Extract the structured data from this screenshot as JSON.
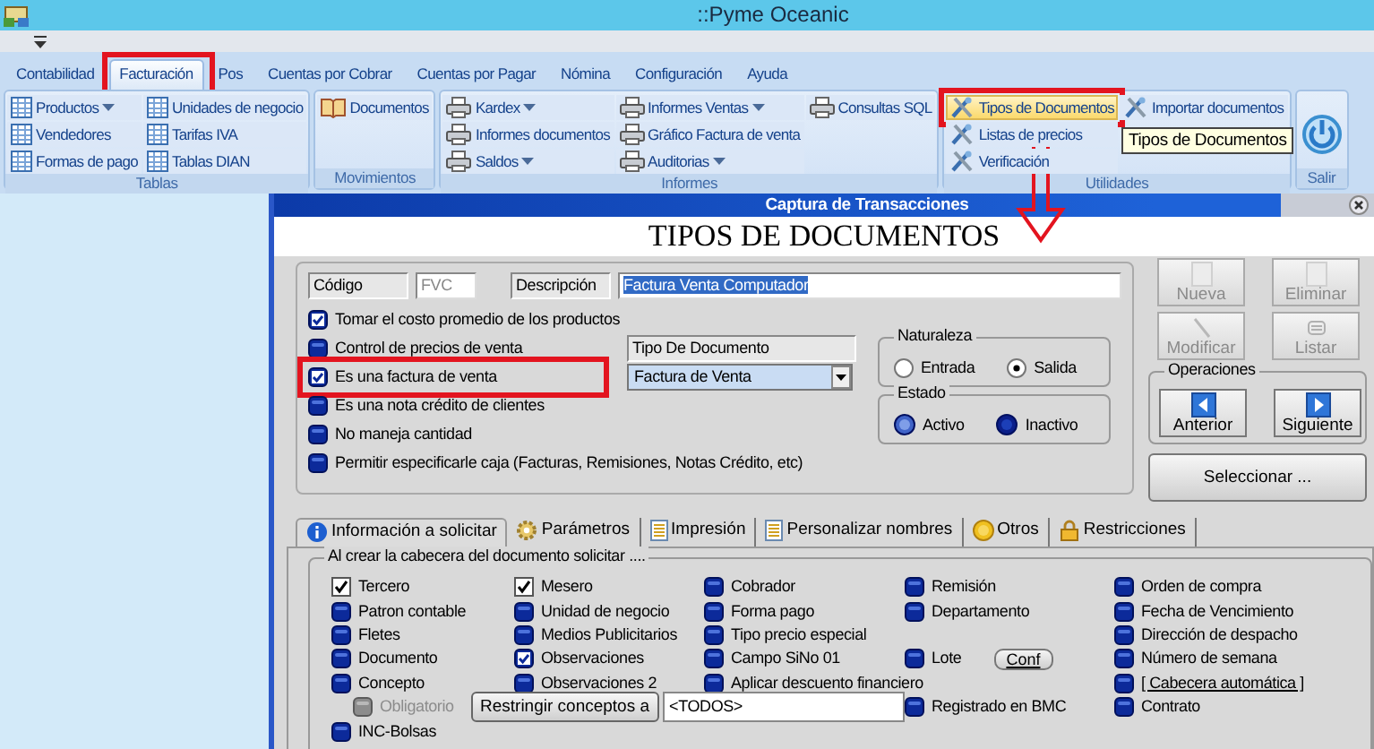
{
  "window": {
    "title": "::Pyme Oceanic"
  },
  "ribbon_tabs": [
    {
      "label": "Contabilidad",
      "selected": false,
      "highlighted": false
    },
    {
      "label": "Facturación",
      "selected": true,
      "highlighted": true
    },
    {
      "label": "Pos",
      "selected": false,
      "highlighted": false
    },
    {
      "label": "Cuentas por Cobrar",
      "selected": false,
      "highlighted": false
    },
    {
      "label": "Cuentas por Pagar",
      "selected": false,
      "highlighted": false
    },
    {
      "label": "Nómina",
      "selected": false,
      "highlighted": false
    },
    {
      "label": "Configuración",
      "selected": false,
      "highlighted": false
    },
    {
      "label": "Ayuda",
      "selected": false,
      "highlighted": false
    }
  ],
  "ribbon_groups": [
    {
      "title": "Tablas",
      "kind": "items",
      "columns": [
        [
          {
            "label": "Productos",
            "kind": "table",
            "dropdown": true,
            "hovered": false,
            "highlighted": false
          },
          {
            "label": "Vendedores",
            "kind": "table",
            "dropdown": false,
            "hovered": false,
            "highlighted": false
          },
          {
            "label": "Formas de pago",
            "kind": "table",
            "dropdown": false,
            "hovered": false,
            "highlighted": false
          }
        ],
        [
          {
            "label": "Unidades de negocio",
            "kind": "table",
            "dropdown": false,
            "hovered": false,
            "highlighted": false
          },
          {
            "label": "Tarifas IVA",
            "kind": "table",
            "dropdown": false,
            "hovered": false,
            "highlighted": false
          },
          {
            "label": "Tablas DIAN",
            "kind": "table",
            "dropdown": false,
            "hovered": false,
            "highlighted": false
          }
        ]
      ]
    },
    {
      "title": "Movimientos",
      "kind": "items",
      "columns": [
        [
          {
            "label": "Documentos",
            "kind": "book",
            "dropdown": false,
            "hovered": false,
            "highlighted": false
          }
        ]
      ]
    },
    {
      "title": "Informes",
      "kind": "items",
      "columns": [
        [
          {
            "label": "Kardex",
            "kind": "printer",
            "dropdown": true,
            "hovered": false,
            "highlighted": false
          },
          {
            "label": "Informes documentos",
            "kind": "printer",
            "dropdown": false,
            "hovered": false,
            "highlighted": false
          },
          {
            "label": "Saldos",
            "kind": "printer",
            "dropdown": true,
            "hovered": false,
            "highlighted": false
          }
        ],
        [
          {
            "label": "Informes Ventas",
            "kind": "printer",
            "dropdown": true,
            "hovered": false,
            "highlighted": false
          },
          {
            "label": "Gráfico Factura de venta",
            "kind": "printer",
            "dropdown": false,
            "hovered": false,
            "highlighted": false
          },
          {
            "label": "Auditorias",
            "kind": "printer",
            "dropdown": true,
            "hovered": false,
            "highlighted": false
          }
        ],
        [
          {
            "label": "Consultas SQL",
            "kind": "printer",
            "dropdown": false,
            "hovered": false,
            "highlighted": false
          }
        ]
      ]
    },
    {
      "title": "Utilidades",
      "kind": "items",
      "columns": [
        [
          {
            "label": "Tipos de Documentos",
            "kind": "tools",
            "dropdown": false,
            "hovered": true,
            "highlighted": true
          },
          {
            "label": "Listas de precios",
            "kind": "tools",
            "dropdown": false,
            "hovered": false,
            "highlighted": false
          },
          {
            "label": "Verificación",
            "kind": "tools",
            "dropdown": false,
            "hovered": false,
            "highlighted": false
          }
        ],
        [
          {
            "label": "Importar documentos",
            "kind": "tools",
            "dropdown": false,
            "hovered": false,
            "highlighted": false
          }
        ]
      ]
    },
    {
      "title": "Salir",
      "kind": "power"
    }
  ],
  "tooltip": {
    "text": "Tipos de Documentos"
  },
  "annotation_arrow": true,
  "dialog": {
    "title": "Captura de Transacciones",
    "heading": "TIPOS DE DOCUMENTOS",
    "code": {
      "label": "Código",
      "value": "FVC",
      "disabled": true
    },
    "description": {
      "label": "Descripción",
      "value": "Factura Venta Computador"
    },
    "options": [
      {
        "label": "Tomar el costo promedio de los productos",
        "checked": true,
        "highlighted": false
      },
      {
        "label": "Control de precios de venta",
        "checked": false,
        "highlighted": false
      },
      {
        "label": "Es una factura de venta",
        "checked": true,
        "highlighted": true
      },
      {
        "label": "Es una nota crédito de clientes",
        "checked": false,
        "highlighted": false
      },
      {
        "label": "No maneja cantidad",
        "checked": false,
        "highlighted": false
      },
      {
        "label": "Permitir especificarle caja  (Facturas, Remisiones, Notas Crédito, etc)",
        "checked": false,
        "highlighted": false
      }
    ],
    "document_type": {
      "label": "Tipo De Documento",
      "value": "Factura de Venta"
    },
    "naturaleza": {
      "title": "Naturaleza",
      "options": [
        {
          "label": "Entrada",
          "selected": false
        },
        {
          "label": "Salida",
          "selected": true
        }
      ]
    },
    "estado": {
      "title": "Estado",
      "options": [
        {
          "label": "Activo",
          "selected": true
        },
        {
          "label": "Inactivo",
          "selected": false
        }
      ]
    },
    "action_buttons": [
      {
        "label": "Nueva",
        "kind": "new",
        "disabled": true
      },
      {
        "label": "Eliminar",
        "kind": "delete",
        "disabled": true
      },
      {
        "label": "Modificar",
        "kind": "edit",
        "disabled": true
      },
      {
        "label": "Listar",
        "kind": "list",
        "disabled": true
      }
    ],
    "operaciones": {
      "title": "Operaciones",
      "buttons": [
        {
          "label": "Anterior",
          "kind": "prev"
        },
        {
          "label": "Siguiente",
          "kind": "next"
        }
      ]
    },
    "select_button": "Seleccionar ...",
    "tabs": [
      {
        "label": "Información a solicitar",
        "kind": "info",
        "selected": true
      },
      {
        "label": "Parámetros",
        "kind": "gear",
        "selected": false
      },
      {
        "label": "Impresión",
        "kind": "page",
        "selected": false
      },
      {
        "label": "Personalizar nombres",
        "kind": "page",
        "selected": false
      },
      {
        "label": "Otros",
        "kind": "coin",
        "selected": false
      },
      {
        "label": "Restricciones",
        "kind": "lock",
        "selected": false
      }
    ],
    "request_title": "Al crear la cabecera del documento solicitar ....",
    "request_rows": [
      [
        {
          "kind": "tickbox",
          "label": "Tercero",
          "checked": true,
          "disabled": false
        },
        {
          "kind": "tickbox",
          "label": "Mesero",
          "checked": true,
          "disabled": false
        },
        {
          "kind": "check",
          "label": "Cobrador",
          "checked": false,
          "disabled": false
        },
        {
          "kind": "check",
          "label": "Remisión",
          "checked": false,
          "disabled": false
        },
        {
          "kind": "check",
          "label": "Orden de compra",
          "checked": false,
          "disabled": false
        }
      ],
      [
        {
          "kind": "check",
          "label": "Patron contable",
          "checked": false,
          "disabled": false
        },
        {
          "kind": "check",
          "label": "Unidad de negocio",
          "checked": false,
          "disabled": false
        },
        {
          "kind": "check",
          "label": "Forma pago",
          "checked": false,
          "disabled": false
        },
        {
          "kind": "check",
          "label": "Departamento",
          "checked": false,
          "disabled": false
        },
        {
          "kind": "check",
          "label": "Fecha de Vencimiento",
          "checked": false,
          "disabled": false
        }
      ],
      [
        {
          "kind": "check",
          "label": "Fletes",
          "checked": false,
          "disabled": false
        },
        {
          "kind": "check",
          "label": "Medios Publicitarios",
          "checked": false,
          "disabled": false
        },
        {
          "kind": "check",
          "label": "Tipo precio especial",
          "checked": false,
          "disabled": false
        },
        null,
        {
          "kind": "check",
          "label": "Dirección de despacho",
          "checked": false,
          "disabled": false
        }
      ],
      [
        {
          "kind": "check",
          "label": "Documento",
          "checked": false,
          "disabled": false
        },
        {
          "kind": "check",
          "label": "Observaciones",
          "checked": true,
          "disabled": false
        },
        {
          "kind": "check",
          "label": "Campo SiNo 01",
          "checked": false,
          "disabled": false
        },
        {
          "kind": "check",
          "label": "Lote",
          "checked": false,
          "disabled": false,
          "button": "Conf"
        },
        {
          "kind": "check",
          "label": "Número de semana",
          "checked": false,
          "disabled": false
        }
      ],
      [
        {
          "kind": "check",
          "label": "Concepto",
          "checked": false,
          "disabled": false
        },
        {
          "kind": "check",
          "label": "Observaciones 2",
          "checked": false,
          "disabled": false
        },
        {
          "kind": "check",
          "label": "Aplicar descuento financiero",
          "checked": false,
          "disabled": false
        },
        null,
        {
          "kind": "link",
          "label": "[ Cabecera automática ]",
          "checked": false
        }
      ],
      [
        {
          "kind": "check",
          "label": "Obligatorio",
          "checked": false,
          "disabled": true
        },
        {
          "kind": "button_field",
          "button": "Restringir conceptos a",
          "value": "<TODOS>"
        },
        null,
        {
          "kind": "check",
          "label": "Registrado en BMC",
          "checked": false,
          "disabled": false
        },
        {
          "kind": "check",
          "label": "Contrato",
          "checked": false,
          "disabled": false
        }
      ],
      [
        {
          "kind": "check",
          "label": "INC-Bolsas",
          "checked": false,
          "disabled": false
        },
        null,
        null,
        null,
        null
      ]
    ]
  }
}
